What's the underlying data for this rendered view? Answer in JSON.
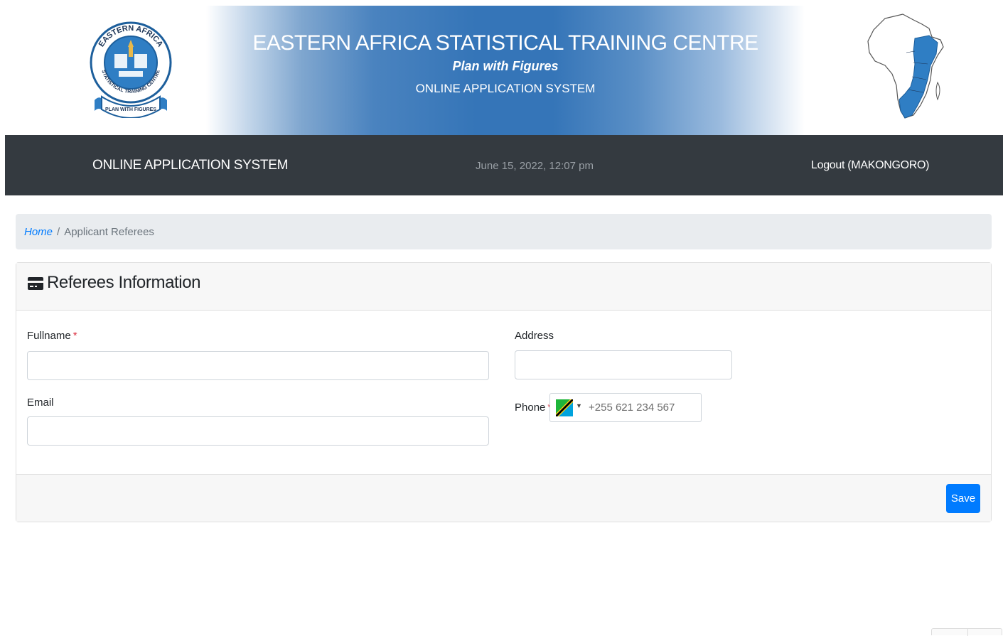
{
  "banner": {
    "title": "EASTERN AFRICA STATISTICAL TRAINING CENTRE",
    "motto": "Plan with Figures",
    "subtitle": "ONLINE APPLICATION SYSTEM",
    "logo_top_text": "EASTERN AFRICA",
    "logo_ring_text": "STATISTICAL TRAINING CENTRE",
    "logo_ribbon_text": "PLAN WITH FIGURES",
    "left_logo_icon": "eastc-seal-logo",
    "right_logo_icon": "africa-map-icon"
  },
  "navbar": {
    "brand": "ONLINE APPLICATION SYSTEM",
    "datetime": "June 15, 2022, 12:07 pm",
    "logout": "Logout (MAKONGORO)"
  },
  "breadcrumb": {
    "home": "Home",
    "separator": "/",
    "current": "Applicant Referees"
  },
  "card": {
    "icon": "credit-card-icon",
    "title": "Referees Information"
  },
  "form": {
    "fullname": {
      "label": "Fullname",
      "required": "*",
      "value": ""
    },
    "email": {
      "label": "Email",
      "value": ""
    },
    "address": {
      "label": "Address",
      "value": ""
    },
    "phone": {
      "label": "Phone",
      "required": "*",
      "placeholder": "+255 621 234 567",
      "country_flag": "tanzania-flag-icon"
    }
  },
  "footer": {
    "save_label": "Save"
  },
  "colors": {
    "banner_blue": "#3575b8",
    "navbar_bg": "#343a40",
    "primary": "#007bff",
    "required": "#dc3545",
    "map_highlight": "#2f7ec4"
  }
}
